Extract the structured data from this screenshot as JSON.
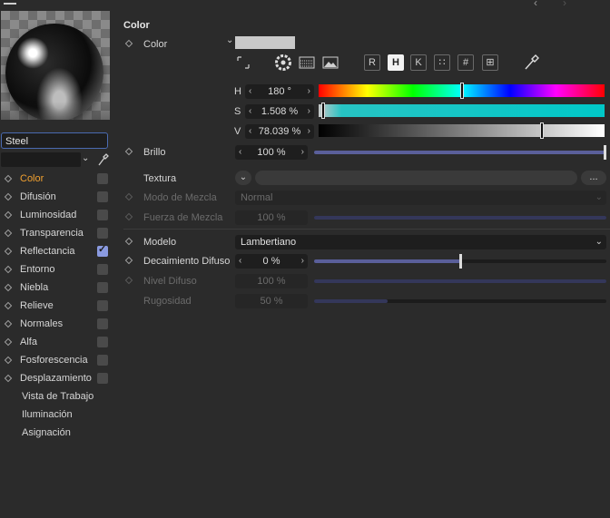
{
  "window": {
    "menu_icon": "hamburger-icon",
    "nav_icons": [
      "back-icon",
      "forward-icon"
    ]
  },
  "material": {
    "name": "Steel"
  },
  "channels": [
    {
      "label": "Color",
      "checkbox": false,
      "active": true
    },
    {
      "label": "Difusión",
      "checkbox": false
    },
    {
      "label": "Luminosidad",
      "checkbox": false
    },
    {
      "label": "Transparencia",
      "checkbox": false
    },
    {
      "label": "Reflectancia",
      "checkbox": true
    },
    {
      "label": "Entorno",
      "checkbox": false
    },
    {
      "label": "Niebla",
      "checkbox": false
    },
    {
      "label": "Relieve",
      "checkbox": false
    },
    {
      "label": "Normales",
      "checkbox": false
    },
    {
      "label": "Alfa",
      "checkbox": false
    },
    {
      "label": "Fosforescencia",
      "checkbox": false
    },
    {
      "label": "Desplazamiento",
      "checkbox": false
    }
  ],
  "extra_items": [
    "Vista de Trabajo",
    "Iluminación",
    "Asignación"
  ],
  "panel": {
    "section_title": "Color",
    "color_label": "Color",
    "swatch_color": "#c9c9c9",
    "modes": [
      "R",
      "H",
      "K",
      "∷",
      "#",
      "⊞"
    ],
    "selected_mode": "H",
    "h": {
      "label": "H",
      "value": "180 °",
      "level": 0.5
    },
    "s": {
      "label": "S",
      "value": "1.508 %",
      "level": 0.015
    },
    "v": {
      "label": "V",
      "value": "78.039 %",
      "level": 0.78
    },
    "brillo": {
      "label": "Brillo",
      "value": "100 %",
      "level": 1.0
    },
    "textura": {
      "label": "Textura",
      "more": "..."
    },
    "modo_mezcla": {
      "label": "Modo de Mezcla",
      "value": "Normal"
    },
    "fuerza_mezcla": {
      "label": "Fuerza de Mezcla",
      "value": "100 %",
      "level": 1.0
    },
    "modelo": {
      "label": "Modelo",
      "value": "Lambertiano"
    },
    "decaimiento": {
      "label": "Decaimiento Difuso",
      "value": "0 %",
      "level": 0.5
    },
    "nivel": {
      "label": "Nivel Difuso",
      "value": "100 %",
      "level": 1.0
    },
    "rugosidad": {
      "label": "Rugosidad",
      "value": "50 %",
      "level": 0.25
    }
  },
  "colors": {
    "accent": "#f0a030",
    "slider_fill": "#5a5f9a",
    "selection_border": "#4a6ab0"
  }
}
